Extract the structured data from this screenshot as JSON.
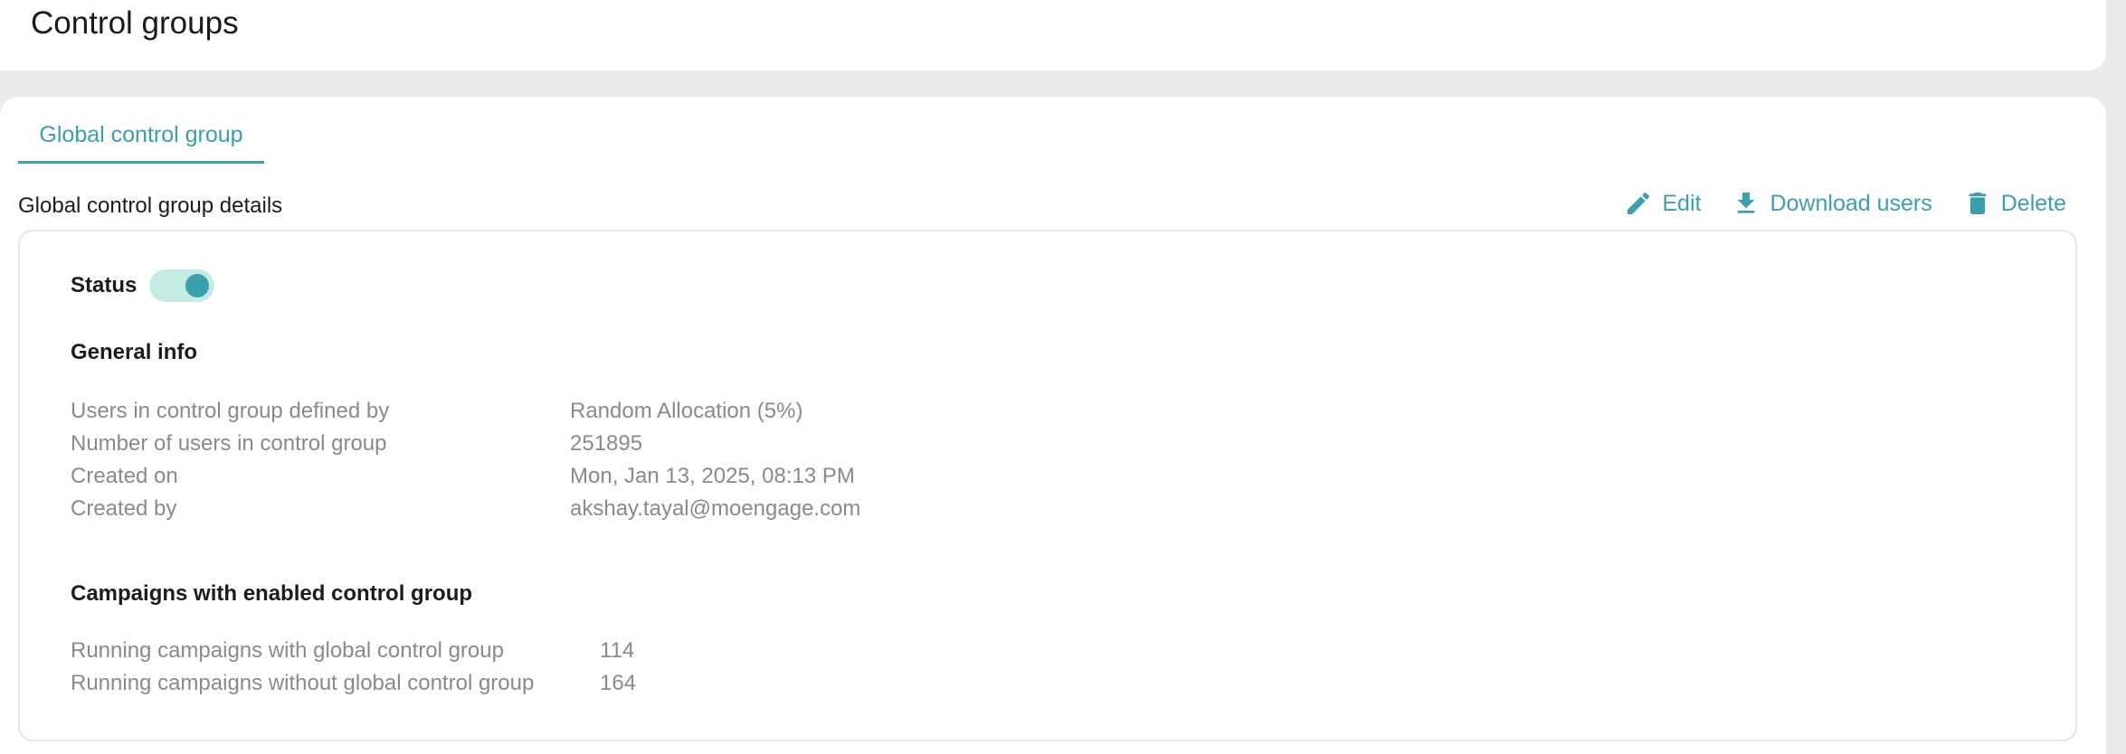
{
  "header": {
    "title": "Control groups"
  },
  "tabs": [
    {
      "label": "Global control group",
      "active": true
    }
  ],
  "section": {
    "title": "Global control group details"
  },
  "actions": {
    "edit_label": "Edit",
    "download_label": "Download users",
    "delete_label": "Delete",
    "icons": [
      "pencil-icon",
      "download-icon",
      "trash-icon"
    ]
  },
  "status": {
    "label": "Status",
    "enabled": true
  },
  "general_info": {
    "heading": "General info",
    "rows": [
      {
        "label": "Users in control group defined by",
        "value": "Random Allocation (5%)"
      },
      {
        "label": "Number of users in control group",
        "value": "251895"
      },
      {
        "label": "Created on",
        "value": "Mon, Jan 13, 2025, 08:13 PM"
      },
      {
        "label": "Created by",
        "value": "akshay.tayal@moengage.com"
      }
    ]
  },
  "campaigns": {
    "heading": "Campaigns with enabled control group",
    "rows": [
      {
        "label": "Running campaigns with global control group",
        "value": "114"
      },
      {
        "label": "Running campaigns without global control group",
        "value": "164"
      }
    ]
  },
  "colors": {
    "accent": "#3aa0ad",
    "toggle_track": "#c4ece4",
    "background": "#ebebeb",
    "muted_text": "#8a8a8a"
  }
}
